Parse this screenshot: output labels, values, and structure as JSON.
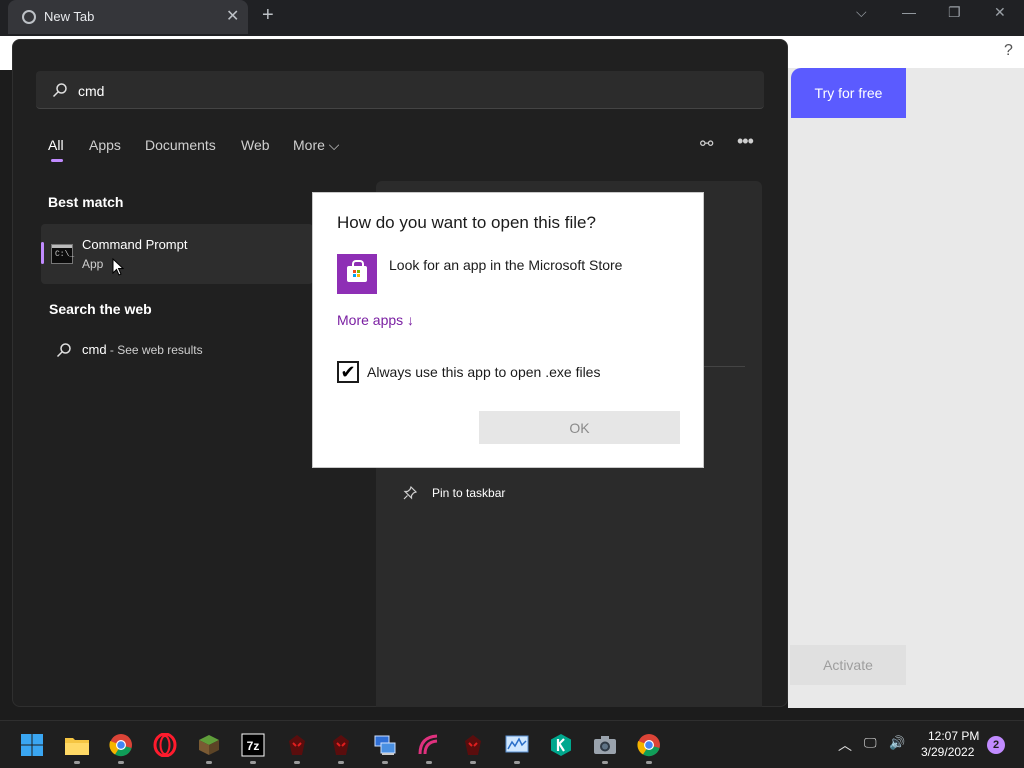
{
  "browser": {
    "tab_title": "New Tab",
    "tab_close": "✕",
    "new_tab": "+",
    "help": "?",
    "controls": {
      "tabs_menu": "⌵",
      "minimize": "—",
      "restore": "❐",
      "close": "✕"
    }
  },
  "page": {
    "try_button": "Try for free",
    "activate_button": "Activate"
  },
  "search": {
    "query": "cmd",
    "filters": [
      "All",
      "Apps",
      "Documents",
      "Web",
      "More ⌵"
    ],
    "active_filter": "All",
    "best_match_title": "Best match",
    "best_match": {
      "name": "Command Prompt",
      "type": "App",
      "icon": "command-prompt-icon"
    },
    "web_title": "Search the web",
    "web_item": {
      "query": "cmd",
      "suffix": " - See web results"
    },
    "preview": {
      "pin_label": "Pin to taskbar"
    },
    "connect_icon": "⚯",
    "more_icon": "•••"
  },
  "dialog": {
    "title": "How do you want to open this file?",
    "store_option": "Look for an app in the Microsoft Store",
    "more_apps": "More apps  ↓",
    "checkbox_label": "Always use this app to open .exe files",
    "checkbox_checked": true,
    "check_mark": "✔",
    "ok": "OK"
  },
  "taskbar": {
    "apps": [
      "start",
      "file-explorer",
      "chrome",
      "opera",
      "minecraft",
      "7zip",
      "app-red-1",
      "app-red-2",
      "remote-desktop",
      "arc-app",
      "app-red-3",
      "monitor-app",
      "kaspersky",
      "camera",
      "chrome-2"
    ],
    "icon_7zip": "7z",
    "tray": {
      "chevron": "︿",
      "network": "🖵",
      "volume": "🔊"
    },
    "time": "12:07 PM",
    "date": "3/29/2022",
    "notifications": "2"
  },
  "colors": {
    "accent": "#c18bff",
    "store": "#8e2fb5",
    "try_button": "#5b5bff"
  }
}
